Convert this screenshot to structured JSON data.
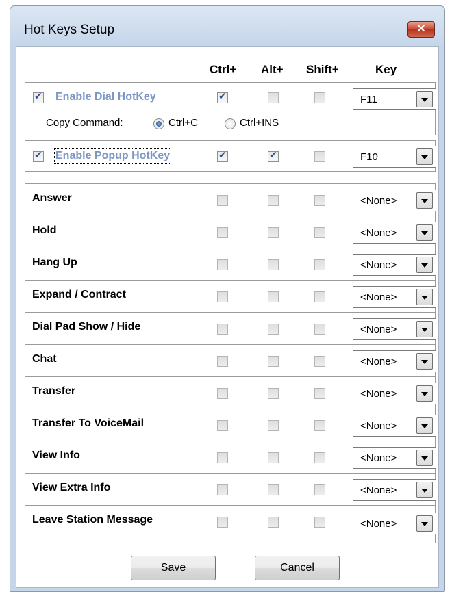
{
  "window": {
    "title": "Hot Keys Setup",
    "close_glyph": "✕"
  },
  "columns": {
    "ctrl": "Ctrl+",
    "alt": "Alt+",
    "shift": "Shift+",
    "key": "Key"
  },
  "dial_hotkey": {
    "label": "Enable Dial HotKey",
    "enabled": true,
    "ctrl": true,
    "alt": false,
    "shift": false,
    "key": "F11",
    "copy_command_label": "Copy Command:",
    "copy_options": [
      "Ctrl+C",
      "Ctrl+INS"
    ],
    "copy_selected": "Ctrl+C"
  },
  "popup_hotkey": {
    "label": "Enable Popup HotKey",
    "enabled": true,
    "ctrl": true,
    "alt": true,
    "shift": false,
    "key": "F10"
  },
  "actions": [
    {
      "label": "Answer",
      "key": "<None>"
    },
    {
      "label": "Hold",
      "key": "<None>"
    },
    {
      "label": "Hang Up",
      "key": "<None>"
    },
    {
      "label": "Expand / Contract",
      "key": "<None>"
    },
    {
      "label": "Dial Pad Show / Hide",
      "key": "<None>"
    },
    {
      "label": "Chat",
      "key": "<None>"
    },
    {
      "label": "Transfer",
      "key": "<None>"
    },
    {
      "label": "Transfer To VoiceMail",
      "key": "<None>"
    },
    {
      "label": "View Info",
      "key": "<None>"
    },
    {
      "label": "View Extra Info",
      "key": "<None>"
    },
    {
      "label": "Leave Station Message",
      "key": "<None>"
    }
  ],
  "buttons": {
    "save": "Save",
    "cancel": "Cancel"
  }
}
